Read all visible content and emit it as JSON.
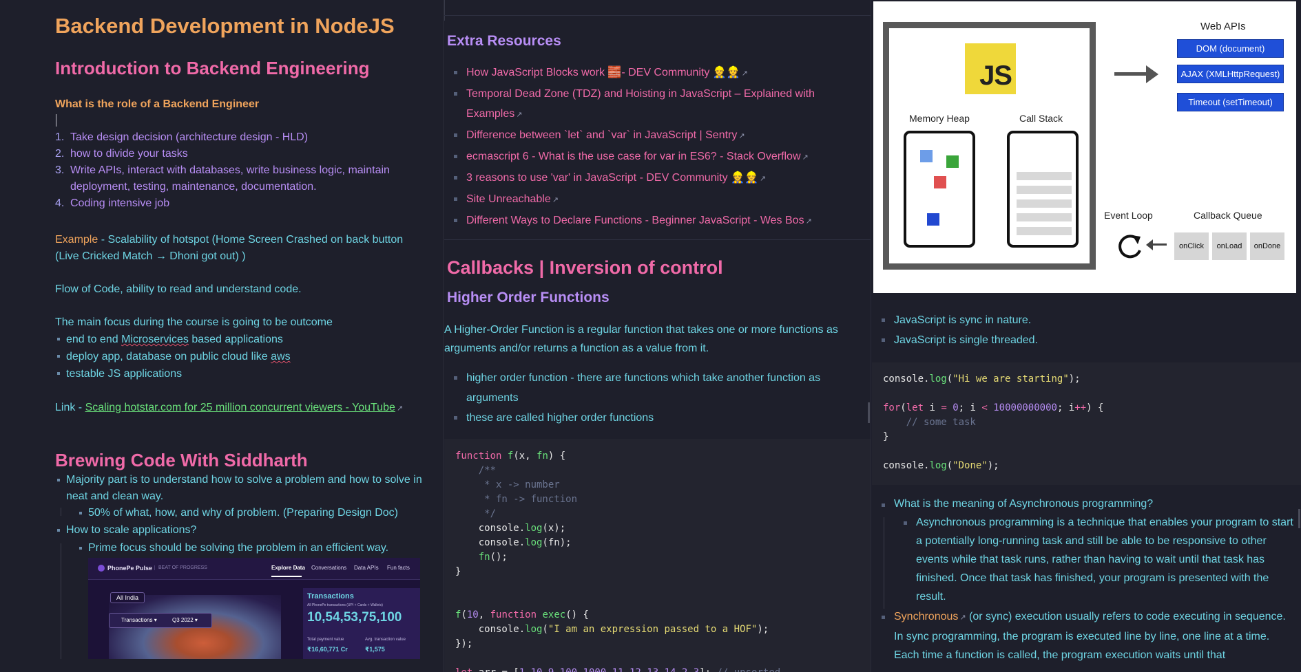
{
  "pane1": {
    "title": "Backend Development in NodeJS",
    "intro_heading": "Introduction to Backend Engineering",
    "role_heading": "What is the role of a Backend Engineer",
    "role_items": [
      {
        "n": "1.",
        "text": "Take design decision (architecture design - HLD)"
      },
      {
        "n": "2.",
        "text": "how to divide your tasks"
      },
      {
        "n": "3.",
        "text": "Write APIs, interact with databases, write business logic, maintain deployment, testing, maintenance, documentation."
      },
      {
        "n": "4.",
        "text": "Coding intensive job"
      }
    ],
    "example_label": "Example",
    "example_text": " - Scalability of hotspot (Home Screen Crashed on back button (Live Cricked Match → Dhoni got out) )",
    "flow_text": "Flow of Code, ability to read and understand code.",
    "focus_text": "The main focus during the course is going to be outcome",
    "focus_items": [
      {
        "pre": "end to end ",
        "squig": "Microservices",
        "post": " based applications"
      },
      {
        "pre": "deploy app, database on public cloud like ",
        "squig": "aws",
        "post": ""
      },
      {
        "pre": "testable JS applications",
        "squig": "",
        "post": ""
      }
    ],
    "link_label": "Link - ",
    "link_text": "Scaling hotstar.com for 25 million concurrent viewers - YouTube",
    "brew_heading": "Brewing Code With Siddharth",
    "brew_item1": "Majority part is to understand how to solve a problem and how to solve in neat and clean way.",
    "brew_sub1": "50% of what, how, and why of problem. (Preparing Design Doc)",
    "brew_item2": "How to scale applications?",
    "brew_sub2": "Prime focus should be solving the problem in an efficient way.",
    "phonepe": {
      "brand": "PhonePe Pulse",
      "tagline": "BEAT OF PROGRESS",
      "nav": [
        "Explore Data",
        "Conversations",
        "Data APIs",
        "Fun facts"
      ],
      "region": "All India",
      "dropdown1": "Transactions ▾",
      "dropdown2": "Q3 2022 ▾",
      "panel_title": "Transactions",
      "panel_sub": "All PhonePe transactions (UPI + Cards + Wallets)",
      "big_value": "10,54,53,75,100",
      "label_total": "Total payment value",
      "label_avg": "Avg. transaction value",
      "val_total": "₹16,60,771 Cr",
      "val_avg": "₹1,575"
    }
  },
  "pane2": {
    "extra_heading": "Extra Resources",
    "resources": [
      "How JavaScript Blocks work 🧱- DEV Community 👷👷",
      "Temporal Dead Zone (TDZ) and Hoisting in JavaScript – Explained with Examples",
      "Difference between `let` and `var` in JavaScript | Sentry",
      "ecmascript 6 - What is the use case for var in ES6? - Stack Overflow",
      "3 reasons to use 'var' in JavaScript - DEV Community 👷👷",
      "Site Unreachable",
      "Different Ways to Declare Functions - Beginner JavaScript - Wes Bos"
    ],
    "callbacks_heading": "Callbacks | Inversion of control",
    "hof_heading": "Higher Order Functions",
    "hof_desc": "A Higher-Order Function is a regular function that takes one or more functions as arguments and/or returns a function as a value from it.",
    "hof_items": [
      "higher order function - there are functions which take another function as arguments",
      "these are called higher order functions"
    ]
  },
  "pane3": {
    "diagram": {
      "js_logo": "JS",
      "memory_heap": "Memory Heap",
      "call_stack": "Call Stack",
      "web_apis": "Web APIs",
      "api_buttons": [
        "DOM (document)",
        "AJAX (XMLHttpRequest)",
        "Timeout (setTimeout)"
      ],
      "event_loop": "Event Loop",
      "callback_queue": "Callback Queue",
      "queue_items": [
        "onClick",
        "onLoad",
        "onDone"
      ]
    },
    "facts": [
      "JavaScript is sync in nature.",
      "JavaScript is single threaded."
    ],
    "async_q": "What is the meaning of Asynchronous programming?",
    "async_a": "Asynchronous programming is a technique that enables your program to start a potentially long-running task and still be able to be responsive to other events while that task runs, rather than having to wait until that task has finished. Once that task has finished, your program is presented with the result.",
    "sync_label": "Synchronous",
    "sync_text": " (or sync) execution usually refers to code executing in sequence. In sync programming, the program is executed line by line, one line at a time. Each time a function is called, the program execution waits until that"
  }
}
